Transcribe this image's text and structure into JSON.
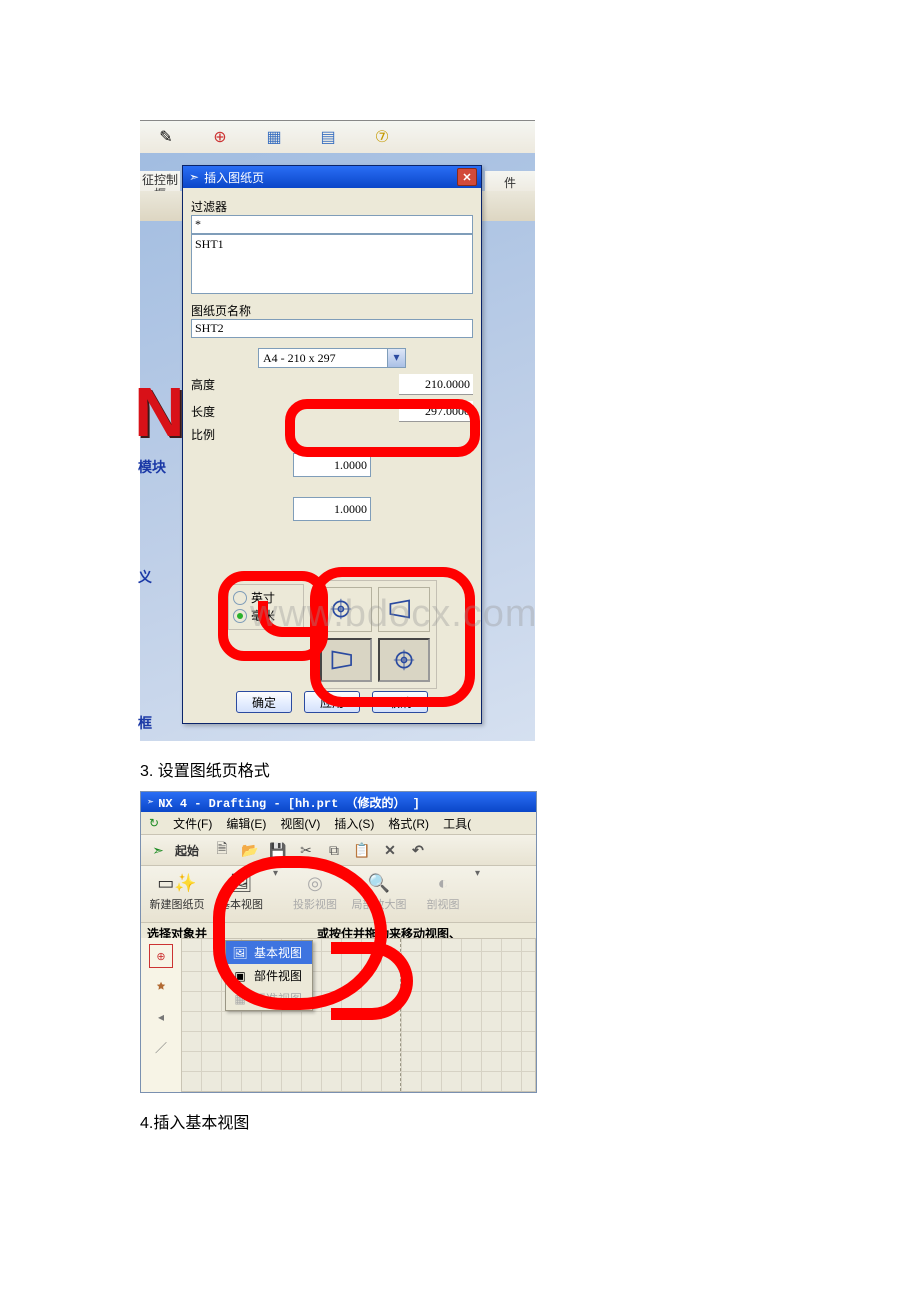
{
  "watermark_text": "www.bdocx.com",
  "shot1": {
    "toolbar_hint_left": "征控制框",
    "toolbar_hint_right": "件",
    "side_words": {
      "a": "模块",
      "b": "义",
      "c": "框"
    },
    "dialog": {
      "title": "插入图纸页",
      "labels": {
        "filter": "过滤器",
        "sheet_name": "图纸页名称",
        "height": "高度",
        "length": "长度",
        "scale": "比例"
      },
      "filter_value": "*",
      "list_item": "SHT1",
      "sheet_name_value": "SHT2",
      "size_dropdown": "A4 - 210 x 297",
      "height_value": "210.0000",
      "length_value": "297.0000",
      "scale_value": "1.0000",
      "scale_value2": "1.0000",
      "units": {
        "inch": "英寸",
        "mm": "毫米"
      },
      "buttons": {
        "ok": "确定",
        "apply": "应用",
        "cancel": "取消"
      }
    }
  },
  "caption1": "3. 设置图纸页格式",
  "shot2": {
    "title": "NX 4 - Drafting - [hh.prt （修改的） ]",
    "menus": {
      "file": "文件(F)",
      "edit": "编辑(E)",
      "view": "视图(V)",
      "insert": "插入(S)",
      "format": "格式(R)",
      "tools": "工具("
    },
    "start_label": "起始",
    "view_toolbar": {
      "new_sheet": "新建图纸页",
      "base_view": "基本视图",
      "proj_view": "投影视图",
      "local_zoom": "局部放大图",
      "section_view": "剖视图"
    },
    "status_text": "选择对象并",
    "status_text_tail": "或按住并拖动来移动视图、",
    "flyout": {
      "base_view": "基本视图",
      "part_view": "部件视图",
      "std_view": "标准视图"
    }
  },
  "caption2": "4.插入基本视图"
}
